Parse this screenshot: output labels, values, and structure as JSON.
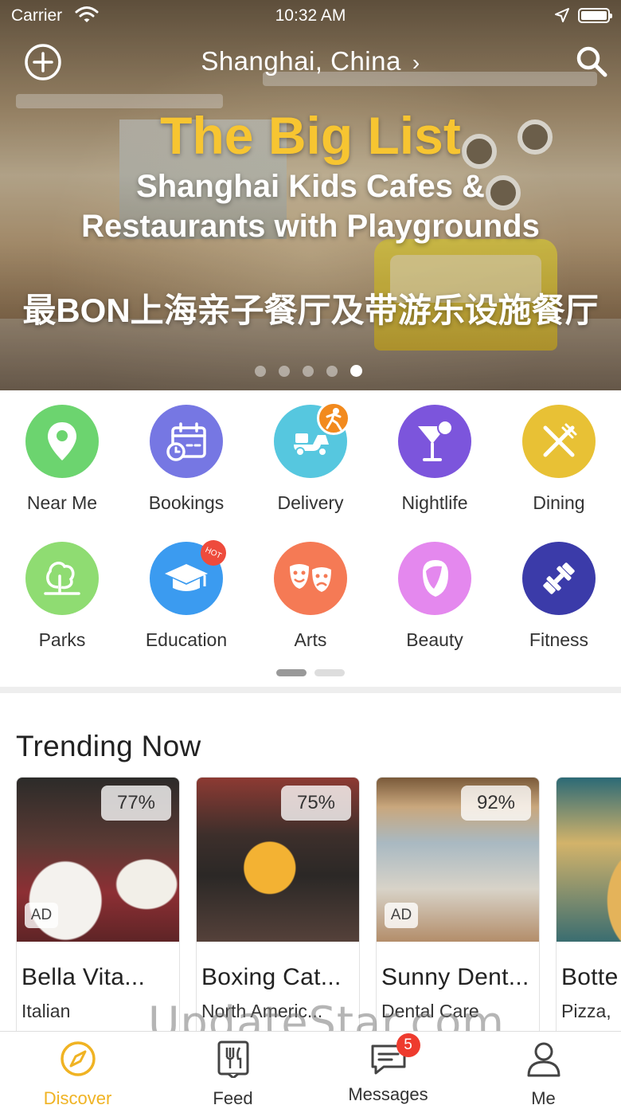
{
  "status_bar": {
    "carrier": "Carrier",
    "time": "10:32 AM"
  },
  "header": {
    "city": "Shanghai, China",
    "chevron": "›"
  },
  "hero": {
    "title": "The Big List",
    "subtitle_line1": "Shanghai Kids Cafes &",
    "subtitle_line2": "Restaurants with Playgrounds",
    "subtitle_cn": "最BON上海亲子餐厅及带游乐设施餐厅",
    "slide_count": 5,
    "active_slide": 5
  },
  "categories": [
    {
      "label": "Near Me",
      "icon": "location-pin-icon",
      "color": "#6cd46f"
    },
    {
      "label": "Bookings",
      "icon": "calendar-icon",
      "color": "#7677e3"
    },
    {
      "label": "Delivery",
      "icon": "scooter-icon",
      "color": "#56c7df"
    },
    {
      "label": "Nightlife",
      "icon": "cocktail-icon",
      "color": "#7c55dc"
    },
    {
      "label": "Dining",
      "icon": "fork-knife-icon",
      "color": "#e8c135"
    },
    {
      "label": "Parks",
      "icon": "tree-icon",
      "color": "#8fdc72"
    },
    {
      "label": "Education",
      "icon": "graduation-cap-icon",
      "color": "#3b9bf0",
      "badge": "HOT"
    },
    {
      "label": "Arts",
      "icon": "theater-masks-icon",
      "color": "#f57a55"
    },
    {
      "label": "Beauty",
      "icon": "face-icon",
      "color": "#e488ee"
    },
    {
      "label": "Fitness",
      "icon": "dumbbell-icon",
      "color": "#3b3ba9"
    }
  ],
  "trending": {
    "title": "Trending Now",
    "items": [
      {
        "name": "Bella Vita...",
        "cuisine": "Italian",
        "percent": "77%",
        "ad": "AD"
      },
      {
        "name": "Boxing Cat...",
        "cuisine": "North Americ...",
        "percent": "75%",
        "ad": ""
      },
      {
        "name": "Sunny Dent...",
        "cuisine": "Dental Care",
        "percent": "92%",
        "ad": "AD"
      },
      {
        "name": "Botte",
        "cuisine": "Pizza,",
        "percent": "",
        "ad": ""
      }
    ]
  },
  "watermark": "UpdateStar.com",
  "tabs": [
    {
      "label": "Discover",
      "icon": "compass-icon",
      "active": true
    },
    {
      "label": "Feed",
      "icon": "utensils-icon",
      "active": false
    },
    {
      "label": "Messages",
      "icon": "chat-icon",
      "active": false,
      "badge": "5"
    },
    {
      "label": "Me",
      "icon": "user-icon",
      "active": false
    }
  ],
  "colors": {
    "accent": "#f0b323",
    "hero_title": "#f7c531",
    "badge_red": "#ee3b2e"
  }
}
